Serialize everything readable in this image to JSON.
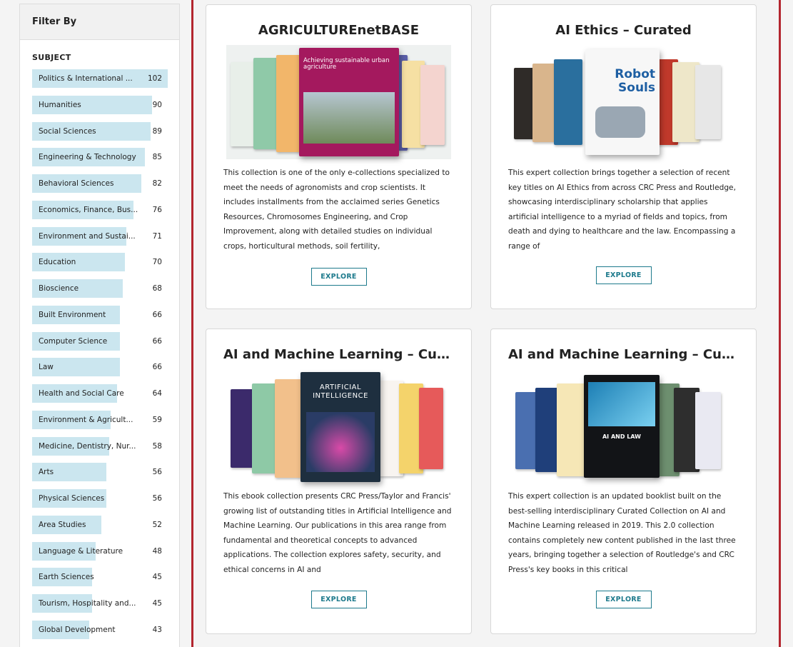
{
  "sidebar": {
    "header": "Filter By",
    "subject_heading": "SUBJECT",
    "items": [
      {
        "label": "Politics & International ...",
        "count": "102"
      },
      {
        "label": "Humanities",
        "count": "90"
      },
      {
        "label": "Social Sciences",
        "count": "89"
      },
      {
        "label": "Engineering & Technology",
        "count": "85"
      },
      {
        "label": "Behavioral Sciences",
        "count": "82"
      },
      {
        "label": "Economics, Finance, Bus...",
        "count": "76"
      },
      {
        "label": "Environment and Sustai...",
        "count": "71"
      },
      {
        "label": "Education",
        "count": "70"
      },
      {
        "label": "Bioscience",
        "count": "68"
      },
      {
        "label": "Built Environment",
        "count": "66"
      },
      {
        "label": "Computer Science",
        "count": "66"
      },
      {
        "label": "Law",
        "count": "66"
      },
      {
        "label": "Health and Social Care",
        "count": "64"
      },
      {
        "label": "Environment & Agricult...",
        "count": "59"
      },
      {
        "label": "Medicine, Dentistry, Nur...",
        "count": "58"
      },
      {
        "label": "Arts",
        "count": "56"
      },
      {
        "label": "Physical Sciences",
        "count": "56"
      },
      {
        "label": "Area Studies",
        "count": "52"
      },
      {
        "label": "Language & Literature",
        "count": "48"
      },
      {
        "label": "Earth Sciences",
        "count": "45"
      },
      {
        "label": "Tourism, Hospitality and...",
        "count": "45"
      },
      {
        "label": "Global Development",
        "count": "43"
      }
    ]
  },
  "cards": [
    {
      "title": "AGRICULTUREnetBASE",
      "cover_title": "Achieving sustainable urban agriculture",
      "description": "This collection is one of the only e-collections specialized to meet the needs of agronomists and crop scientists. It includes installments from the acclaimed series Genetics Resources, Chromosomes Engineering, and Crop Improvement, along with detailed studies on individual crops, horticultural methods, soil fertility,",
      "button": "EXPLORE"
    },
    {
      "title": "AI Ethics – Curated",
      "cover_title": "Robot Souls",
      "description": "This expert collection brings together a selection of recent key titles on AI Ethics from across CRC Press and Routledge, showcasing interdisciplinary scholarship that applies artificial intelligence to a myriad of fields and topics, from death and dying to healthcare and the law. Encompassing a range of",
      "button": "EXPLORE"
    },
    {
      "title": "AI and Machine Learning – Curat...",
      "cover_title": "ARTIFICIAL INTELLIGENCE",
      "description": "This ebook collection presents CRC Press/Taylor and Francis' growing list of outstanding titles in Artificial Intelligence and Machine Learning. Our publications in this area range from fundamental and theoretical concepts to advanced applications. The collection explores safety, security, and ethical concerns in AI and",
      "button": "EXPLORE"
    },
    {
      "title": "AI and Machine Learning – Curat...",
      "cover_title": "AI AND LAW",
      "description": "This expert collection is an updated booklist built on the best-selling interdisciplinary Curated Collection on AI and Machine Learning released in 2019. This 2.0 collection contains completely new content published in the last three years, bringing together a selection of Routledge's and CRC Press's key books in this critical",
      "button": "EXPLORE"
    }
  ],
  "colors": {
    "accent_border": "#b3262f",
    "button": "#1d7a8c",
    "filter_bar": "#cbe6ef"
  }
}
